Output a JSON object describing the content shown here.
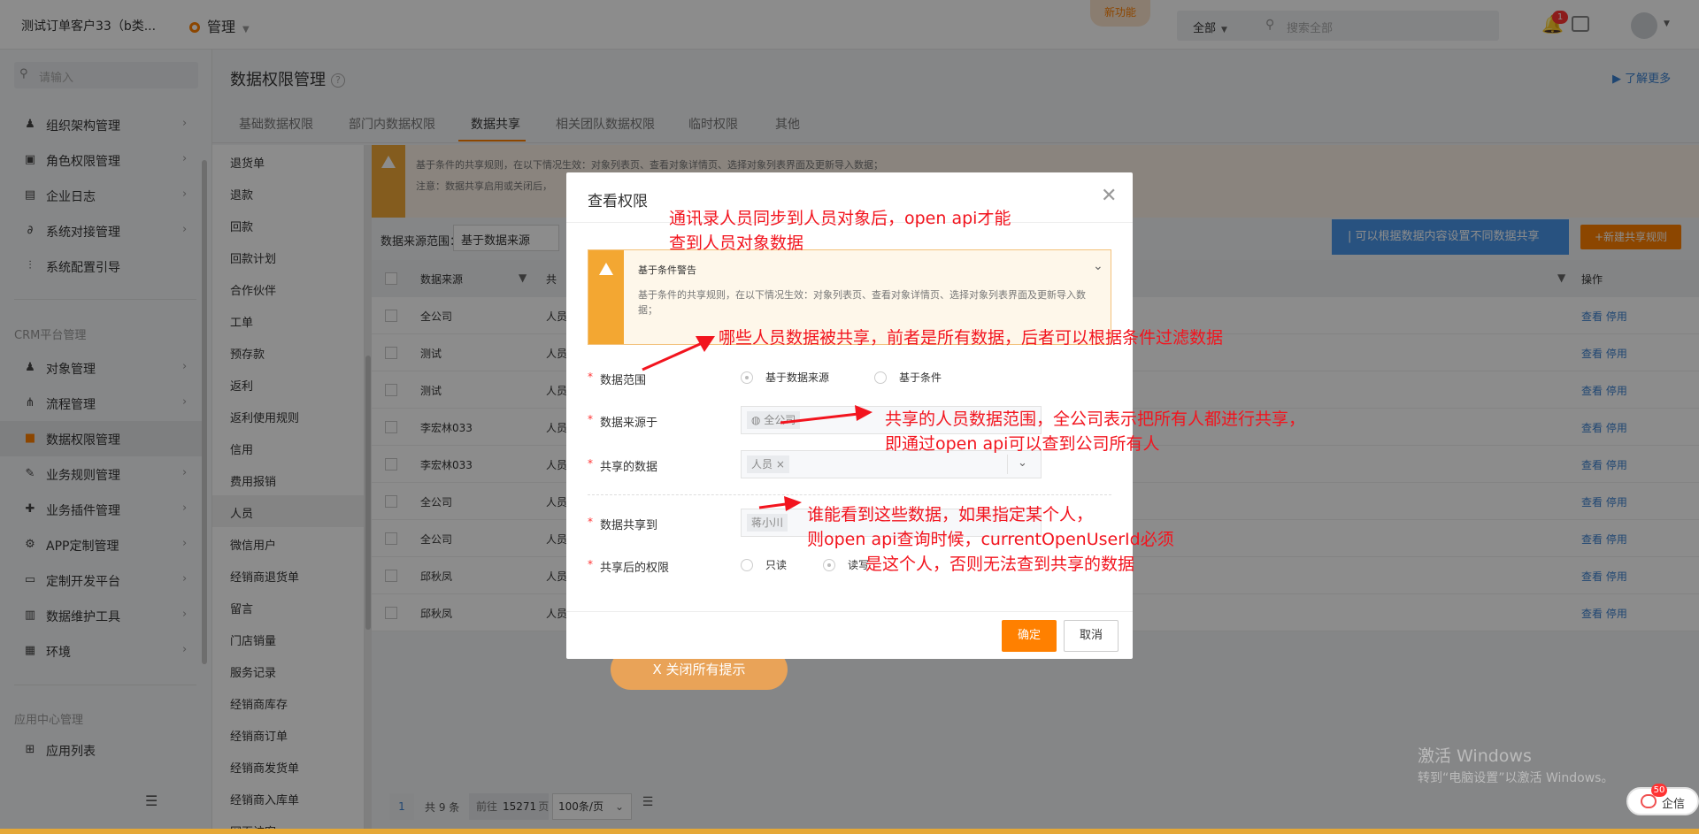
{
  "topbar": {
    "tenant": "测试订单客户33（b类...",
    "app": "管理",
    "new_feature": "新功能",
    "search_scope": "全部",
    "search_placeholder": "搜索全部",
    "notif_count": "1"
  },
  "sidebar": {
    "search_placeholder": "请输入",
    "items": [
      {
        "label": "组织架构管理",
        "icon": "org-icon"
      },
      {
        "label": "角色权限管理",
        "icon": "role-icon"
      },
      {
        "label": "企业日志",
        "icon": "log-icon"
      },
      {
        "label": "系统对接管理",
        "icon": "link-icon"
      },
      {
        "label": "系统配置引导",
        "icon": "sliders-icon"
      }
    ],
    "crm_section": "CRM平台管理",
    "crm_items": [
      {
        "label": "对象管理",
        "icon": "object-icon"
      },
      {
        "label": "流程管理",
        "icon": "flow-icon"
      },
      {
        "label": "数据权限管理",
        "icon": "lock-icon"
      },
      {
        "label": "业务规则管理",
        "icon": "wrench-icon"
      },
      {
        "label": "业务插件管理",
        "icon": "puzzle-icon"
      },
      {
        "label": "APP定制管理",
        "icon": "app-icon"
      },
      {
        "label": "定制开发平台",
        "icon": "code-icon"
      },
      {
        "label": "数据维护工具",
        "icon": "chart-icon"
      },
      {
        "label": "环境",
        "icon": "env-icon"
      }
    ],
    "app_section": "应用中心管理",
    "app_items": [
      {
        "label": "应用列表",
        "icon": "grid-icon"
      }
    ]
  },
  "page": {
    "title": "数据权限管理",
    "learn_more": "了解更多",
    "tabs": [
      "基础数据权限",
      "部门内数据权限",
      "数据共享",
      "相关团队数据权限",
      "临时权限",
      "其他"
    ]
  },
  "objects": [
    "退货单",
    "退款",
    "回款",
    "回款计划",
    "合作伙伴",
    "工单",
    "预存款",
    "返利",
    "返利使用规则",
    "信用",
    "费用报销",
    "人员",
    "微信用户",
    "经销商退货单",
    "留言",
    "门店销量",
    "服务记录",
    "经销商库存",
    "经销商订单",
    "经销商发货单",
    "经销商入库单",
    "网页访客"
  ],
  "content": {
    "warn_line1": "基于条件的共享规则，在以下情况生效：对象列表页、查看对象详情页、选择对象列表界面及更新导入数据；",
    "warn_line2": "注意：数据共享启用或关闭后，",
    "range_label": "数据来源范围：",
    "range_value": "基于数据来源",
    "tip_button": "可以根据数据内容设置不同数据共享",
    "new_rule_button": "+新建共享规则",
    "columns": {
      "source": "数据来源",
      "share": "共",
      "ops": "操作"
    },
    "rows": [
      {
        "source": "全公司",
        "share": "人员"
      },
      {
        "source": "测试",
        "share": "人员"
      },
      {
        "source": "测试",
        "share": "人员"
      },
      {
        "source": "李宏林033",
        "share": "人员"
      },
      {
        "source": "李宏林033",
        "share": "人员"
      },
      {
        "source": "全公司",
        "share": "人员"
      },
      {
        "source": "全公司",
        "share": "人员"
      },
      {
        "source": "邱秋凤",
        "share": "人员"
      },
      {
        "source": "邱秋凤",
        "share": "人员"
      }
    ],
    "row_actions": "查看 停用",
    "close_all": "X 关闭所有提示",
    "pager": {
      "current": "1",
      "total": "共 9 条",
      "goto_label": "前往",
      "goto_page": "15271",
      "page_unit": "页",
      "page_size": "100条/页"
    }
  },
  "dialog": {
    "title": "查看权限",
    "warn_title": "基于条件警告",
    "warn_body": "基于条件的共享规则，在以下情况生效：对象列表页、查看对象详情页、选择对象列表界面及更新导入数据；",
    "fields": {
      "range": {
        "label": "数据范围",
        "opt1": "基于数据来源",
        "opt2": "基于条件"
      },
      "source": {
        "label": "数据来源于",
        "tag": "全公司"
      },
      "shared": {
        "label": "共享的数据",
        "tag": "人员 ×"
      },
      "target": {
        "label": "数据共享到",
        "tag": "蒋小川"
      },
      "perm": {
        "label": "共享后的权限",
        "opt1": "只读",
        "opt2": "读写"
      }
    },
    "ok": "确定",
    "cancel": "取消"
  },
  "annotations": {
    "a1_line1": "通讯录人员同步到人员对象后，open api才能",
    "a1_line2": "查到人员对象数据",
    "a2": "哪些人员数据被共享，前者是所有数据，后者可以根据条件过滤数据",
    "a3_line1": "共享的人员数据范围，全公司表示把所有人都进行共享，",
    "a3_line2": "即通过open api可以查到公司所有人",
    "a4_line1": "谁能看到这些数据，如果指定某个人，",
    "a4_line2": "则open api查询时候，currentOpenUserId必须",
    "a4_line3": "是这个人，否则无法查到共享的数据"
  },
  "watermark": {
    "line1": "激活 Windows",
    "line2": "转到“电脑设置”以激活 Windows。"
  },
  "qixin": {
    "badge": "50",
    "label": "企信"
  }
}
